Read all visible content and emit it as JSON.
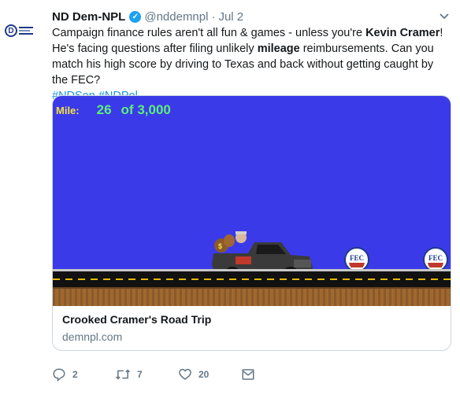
{
  "tweet": {
    "display_name": "ND Dem-NPL",
    "handle": "@nddemnpl",
    "separator": "·",
    "date": "Jul 2",
    "text_part1": "Campaign finance rules aren't all fun & games - unless you're ",
    "text_bold1": "Kevin Cramer",
    "text_part2": "! He's facing questions after filing unlikely ",
    "text_bold2": "mileage",
    "text_part3": " reimbursements. Can you match his high score by driving to Texas and back without getting caught by the FEC?",
    "hashtags": [
      "#NDSen",
      "#NDPol"
    ]
  },
  "card": {
    "game": {
      "mile_label": "Mile:",
      "mile_value": "26",
      "mile_total": "of 3,000",
      "sign_text": "FEC",
      "colors": {
        "sky": "#3b3ae8",
        "mile_label": "#f5e342",
        "mile_value": "#5cf07a",
        "road_stripe": "#e6b800"
      }
    },
    "title": "Crooked Cramer's Road Trip",
    "domain": "demnpl.com"
  },
  "actions": {
    "reply_count": "2",
    "retweet_count": "7",
    "like_count": "20",
    "icons": [
      "reply-icon",
      "retweet-icon",
      "like-icon",
      "message-icon"
    ]
  },
  "colors": {
    "link": "#1b95e0",
    "muted": "#657786",
    "verified": "#1da1f2"
  }
}
